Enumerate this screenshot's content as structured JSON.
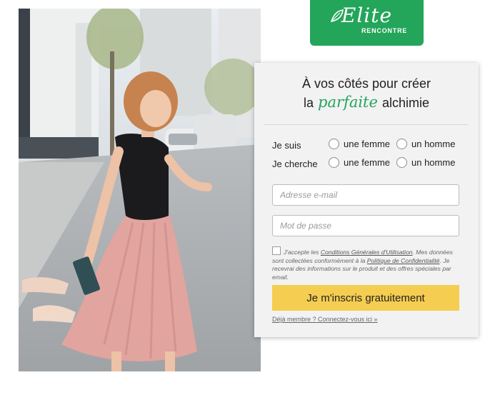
{
  "logo": {
    "word": "Elite",
    "sub": "RENCONTRE",
    "color": "#23a55a"
  },
  "headline": {
    "line1": "À vos côtés pour créer",
    "line2_pre": "la",
    "line2_accent": "parfaite",
    "line2_post": "alchimie"
  },
  "form": {
    "i_am": {
      "label": "Je suis",
      "option1": "une femme",
      "option2": "un homme"
    },
    "seeking": {
      "label": "Je cherche",
      "option1": "une femme",
      "option2": "un homme"
    },
    "email_placeholder": "Adresse e-mail",
    "password_placeholder": "Mot de passe",
    "consent": {
      "t1": "J'accepte les ",
      "link1": "Conditions Générales d'Utilisation",
      "t2": ". Mes données sont collectées conformément à la ",
      "link2": "Politique de Confidentialité",
      "t3": ". Je recevrai des informations sur le produit et des offres spéciales par email."
    },
    "submit_label": "Je m'inscris gratuitement",
    "submit_color": "#f5cd51",
    "login_link": "Déjà membre ? Connectez-vous ici »"
  }
}
